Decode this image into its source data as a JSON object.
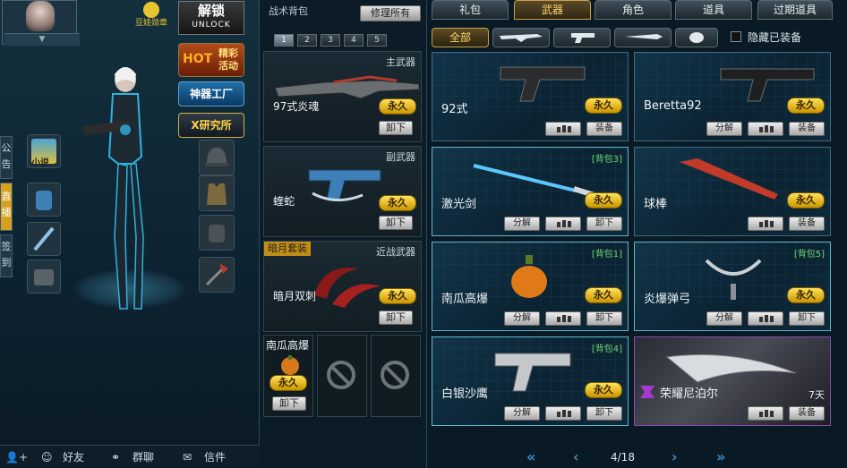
{
  "left": {
    "doudou_label": "豆娃勋章",
    "unlock": {
      "title": "解锁",
      "sub": "UNLOCK"
    },
    "hot": {
      "tag": "HOT",
      "line1": "精彩",
      "line2": "活动"
    },
    "shenqi": "神器工厂",
    "xyan": "X研究所",
    "side_tabs": [
      "公告",
      "直播",
      "签到"
    ],
    "novel_label": "小说",
    "bottom": {
      "friends": "好友",
      "group": "群聊",
      "mail": "信件"
    }
  },
  "middle": {
    "title": "战术背包",
    "repair": "修理所有",
    "num_tabs": [
      "1",
      "2",
      "3",
      "4",
      "5"
    ],
    "slots": [
      {
        "type": "主武器",
        "name": "97式炎魂",
        "status": "永久",
        "action": "卸下"
      },
      {
        "type": "副武器",
        "name": "蝰蛇",
        "status": "永久",
        "action": "卸下"
      },
      {
        "type": "近战武器",
        "name": "暗月双刺",
        "status": "永久",
        "action": "卸下",
        "set": "暗月套装"
      }
    ],
    "grenade": {
      "name": "南瓜高爆",
      "status": "永久",
      "action": "卸下"
    }
  },
  "right": {
    "tabs": [
      "礼包",
      "武器",
      "角色",
      "道具",
      "过期道具"
    ],
    "filter_all": "全部",
    "hide_equipped": "隐藏已装备",
    "cards": [
      {
        "name": "92式",
        "status": "永久",
        "btn1": "",
        "btn2": "装备",
        "bag": ""
      },
      {
        "name": "Beretta92",
        "status": "永久",
        "btn1": "分解",
        "btn2": "装备",
        "bag": ""
      },
      {
        "name": "激光剑",
        "status": "永久",
        "btn1": "分解",
        "btn2": "卸下",
        "bag": "[背包3]"
      },
      {
        "name": "球棒",
        "status": "永久",
        "btn1": "",
        "btn2": "装备",
        "bag": ""
      },
      {
        "name": "南瓜高爆",
        "status": "永久",
        "btn1": "分解",
        "btn2": "卸下",
        "bag": "[背包1]"
      },
      {
        "name": "炎爆弹弓",
        "status": "永久",
        "btn1": "分解",
        "btn2": "卸下",
        "bag": "[背包5]"
      },
      {
        "name": "白银沙鹰",
        "status": "永久",
        "btn1": "分解",
        "btn2": "卸下",
        "bag": "[背包4]"
      },
      {
        "name": "荣耀尼泊尔",
        "status": "7天",
        "btn1": "",
        "btn2": "装备",
        "bag": ""
      }
    ],
    "pager": "4/18"
  },
  "colors": {
    "gold": "#ffd86a",
    "yongjiu": "#f2c418",
    "bag_green": "#6fd86f",
    "accent_blue": "#3a8fd2"
  }
}
